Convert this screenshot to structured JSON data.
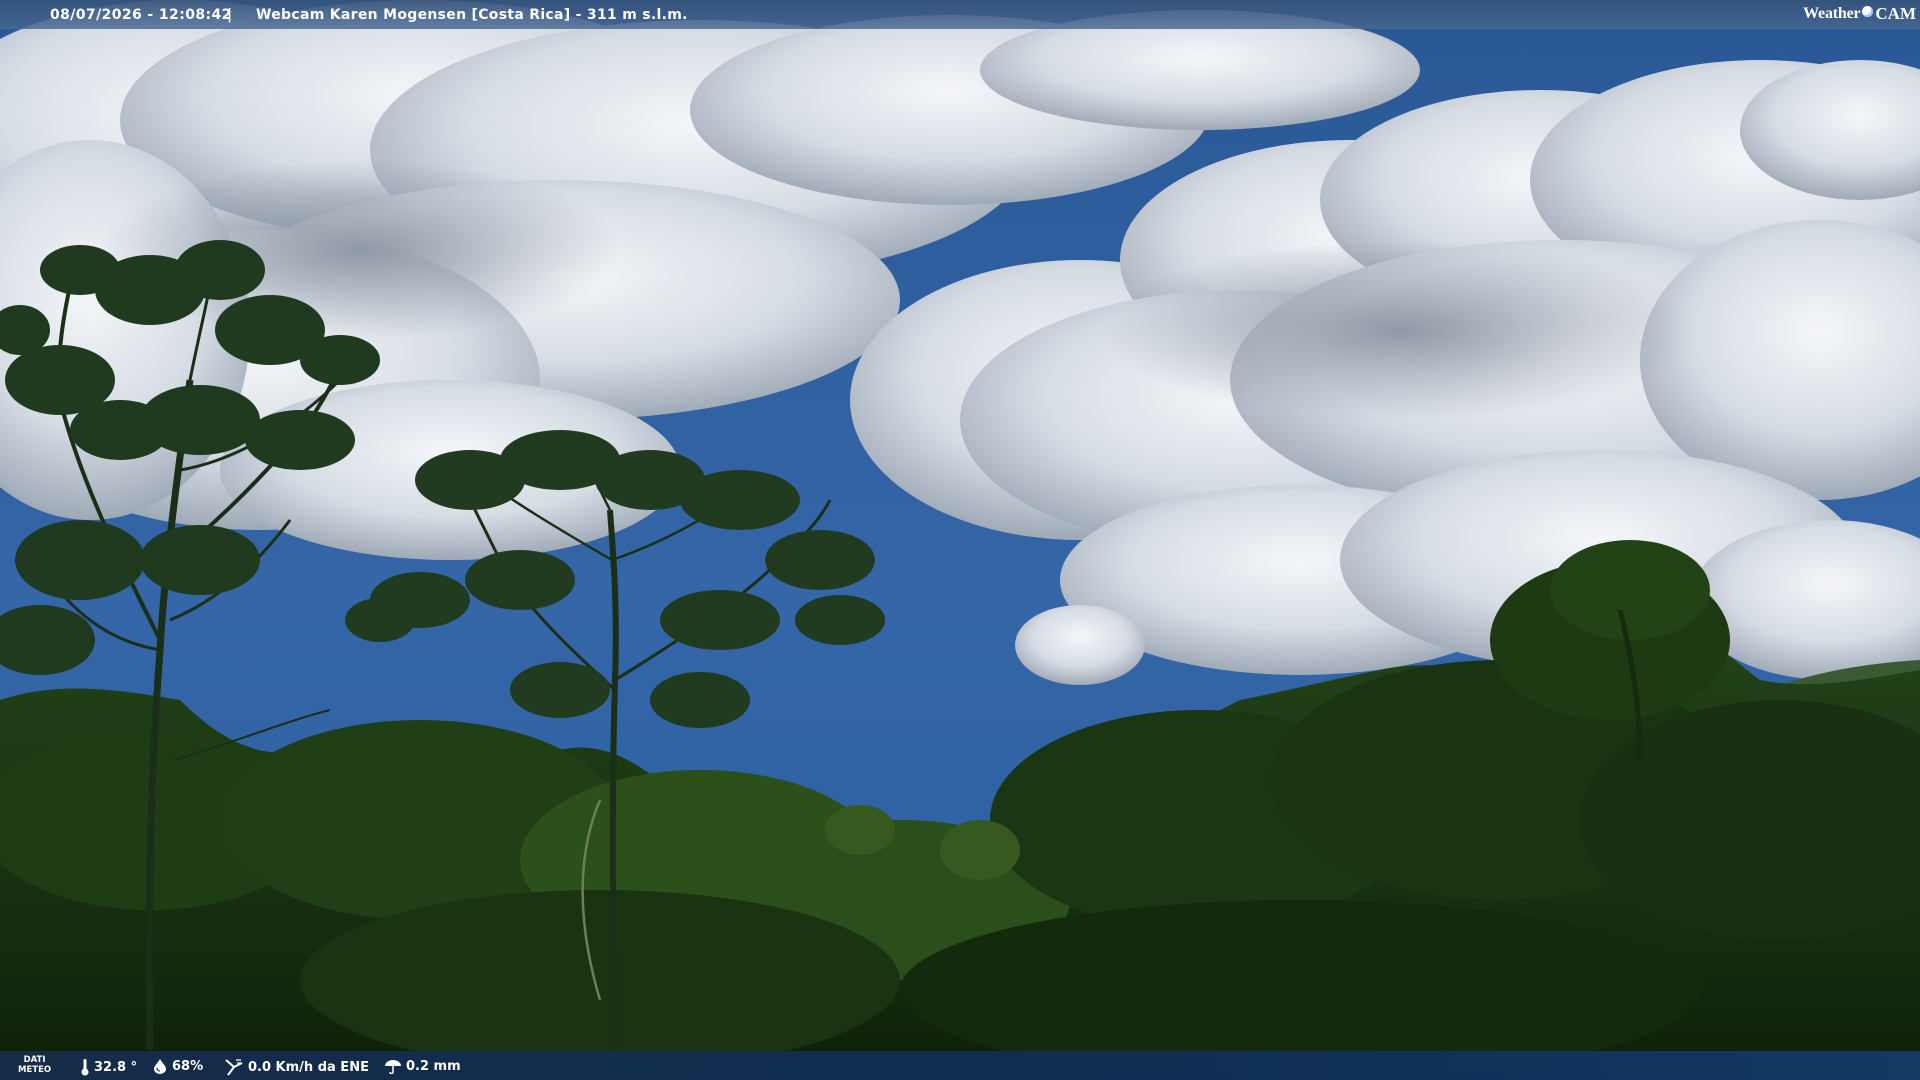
{
  "overlay": {
    "timestamp": "08/07/2026 - 12:08:42",
    "separator": "|",
    "title": "Webcam Karen Mogensen [Costa Rica] - 311 m s.l.m.",
    "logo": {
      "word1": "Weather",
      "word2": "CAM"
    }
  },
  "weather_bar": {
    "label_line1": "DATI",
    "label_line2": "METEO",
    "temperature": "32.8 °",
    "humidity": "68%",
    "wind": "0.0 Km/h da ENE",
    "rain": "0.2 mm"
  },
  "icons": {
    "temperature": "thermometer-icon",
    "humidity": "water-drop-icon",
    "wind": "wind-vane-icon",
    "rain": "rain-gauge-icon"
  },
  "colors": {
    "sky": "#2e5d9c",
    "cloud": "#eef2f7",
    "foliage": "#1c3a14",
    "bar": "#12305a"
  }
}
